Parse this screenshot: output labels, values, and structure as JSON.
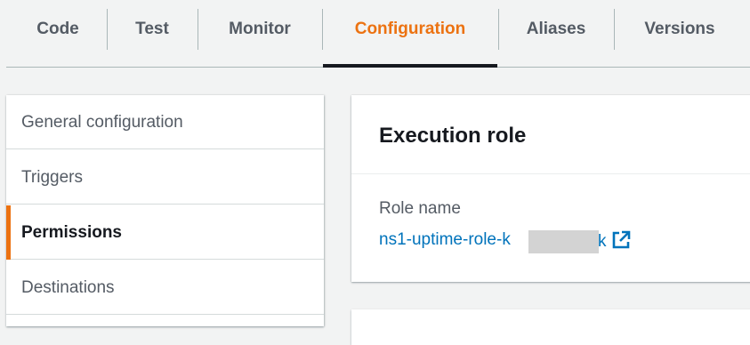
{
  "tabs": [
    {
      "label": "Code",
      "active": false
    },
    {
      "label": "Test",
      "active": false
    },
    {
      "label": "Monitor",
      "active": false
    },
    {
      "label": "Configuration",
      "active": true
    },
    {
      "label": "Aliases",
      "active": false
    },
    {
      "label": "Versions",
      "active": false
    }
  ],
  "sidenav": {
    "items": [
      {
        "label": "General configuration",
        "active": false
      },
      {
        "label": "Triggers",
        "active": false
      },
      {
        "label": "Permissions",
        "active": true
      },
      {
        "label": "Destinations",
        "active": false
      }
    ]
  },
  "execution_role": {
    "title": "Execution role",
    "role_name_label": "Role name",
    "role_name_value": "ns1-uptime-role-k",
    "role_name_tail": "k",
    "link_icon": "external-link-icon"
  },
  "colors": {
    "accent": "#ec7211",
    "link": "#0073bb",
    "background": "#f2f3f3"
  }
}
